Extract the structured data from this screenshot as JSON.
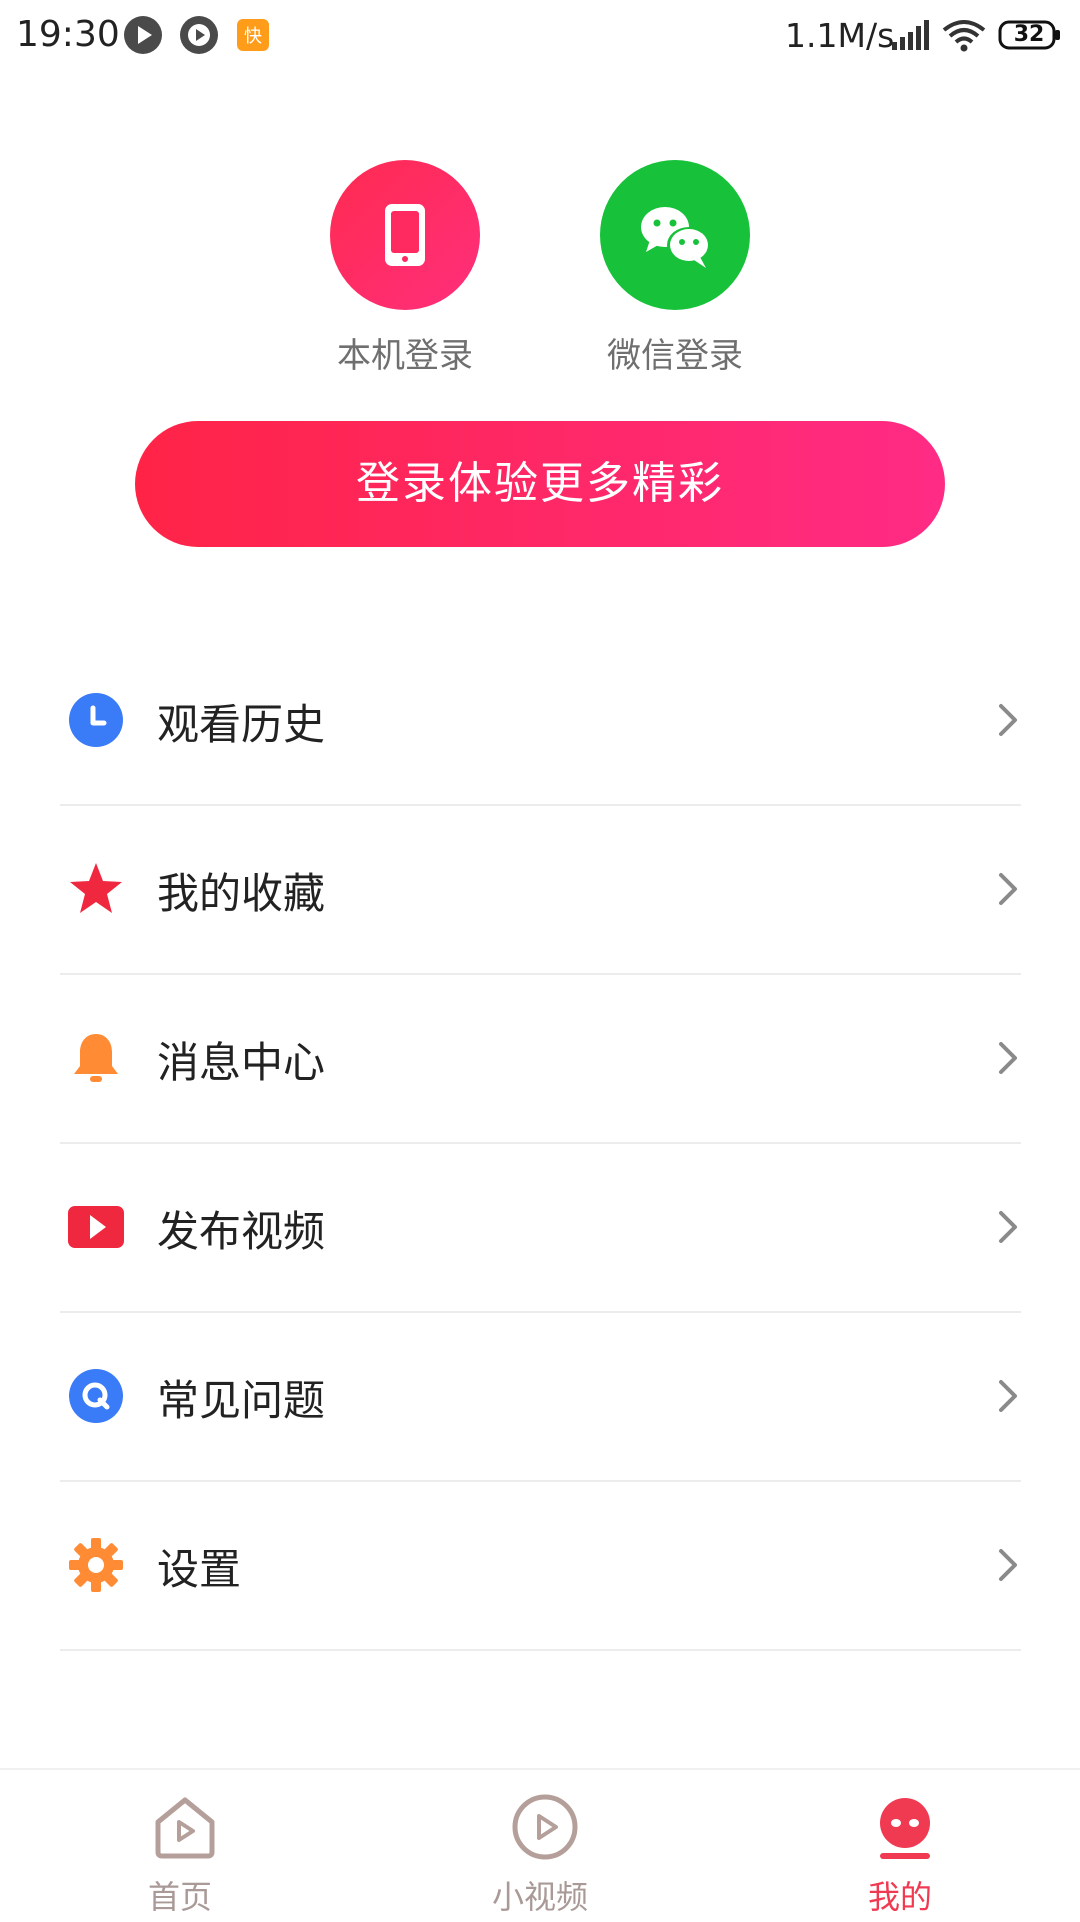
{
  "status_bar": {
    "time": "19:30",
    "network_speed": "1.1M/s",
    "battery_level": "32",
    "icons": [
      "play-circle-icon",
      "video-gear-icon",
      "app-badge-icon",
      "signal-icon",
      "wifi-icon",
      "battery-icon"
    ]
  },
  "login": {
    "options": [
      {
        "label": "本机登录",
        "icon": "phone-icon",
        "color": "#ff2a5f"
      },
      {
        "label": "微信登录",
        "icon": "wechat-icon",
        "color": "#17c23a"
      }
    ],
    "main_button": "登录体验更多精彩",
    "main_button_colors": [
      "#ff2446",
      "#ff2b85"
    ]
  },
  "menu": {
    "items": [
      {
        "label": "观看历史",
        "icon": "clock-icon",
        "color": "#3a7bf7"
      },
      {
        "label": "我的收藏",
        "icon": "star-icon",
        "color": "#f0283f"
      },
      {
        "label": "消息中心",
        "icon": "bell-icon",
        "color": "#ff8c34"
      },
      {
        "label": "发布视频",
        "icon": "video-play-icon",
        "color": "#f0283f"
      },
      {
        "label": "常见问题",
        "icon": "question-icon",
        "color": "#3a7bf7"
      },
      {
        "label": "设置",
        "icon": "gear-icon",
        "color": "#ff8c34"
      }
    ]
  },
  "bottom_nav": {
    "items": [
      {
        "label": "首页",
        "icon": "home-icon",
        "active": false
      },
      {
        "label": "小视频",
        "icon": "play-circle-icon",
        "active": false
      },
      {
        "label": "我的",
        "icon": "profile-face-icon",
        "active": true
      }
    ],
    "active_color": "#f03a52",
    "inactive_color": "#aa9a97"
  }
}
